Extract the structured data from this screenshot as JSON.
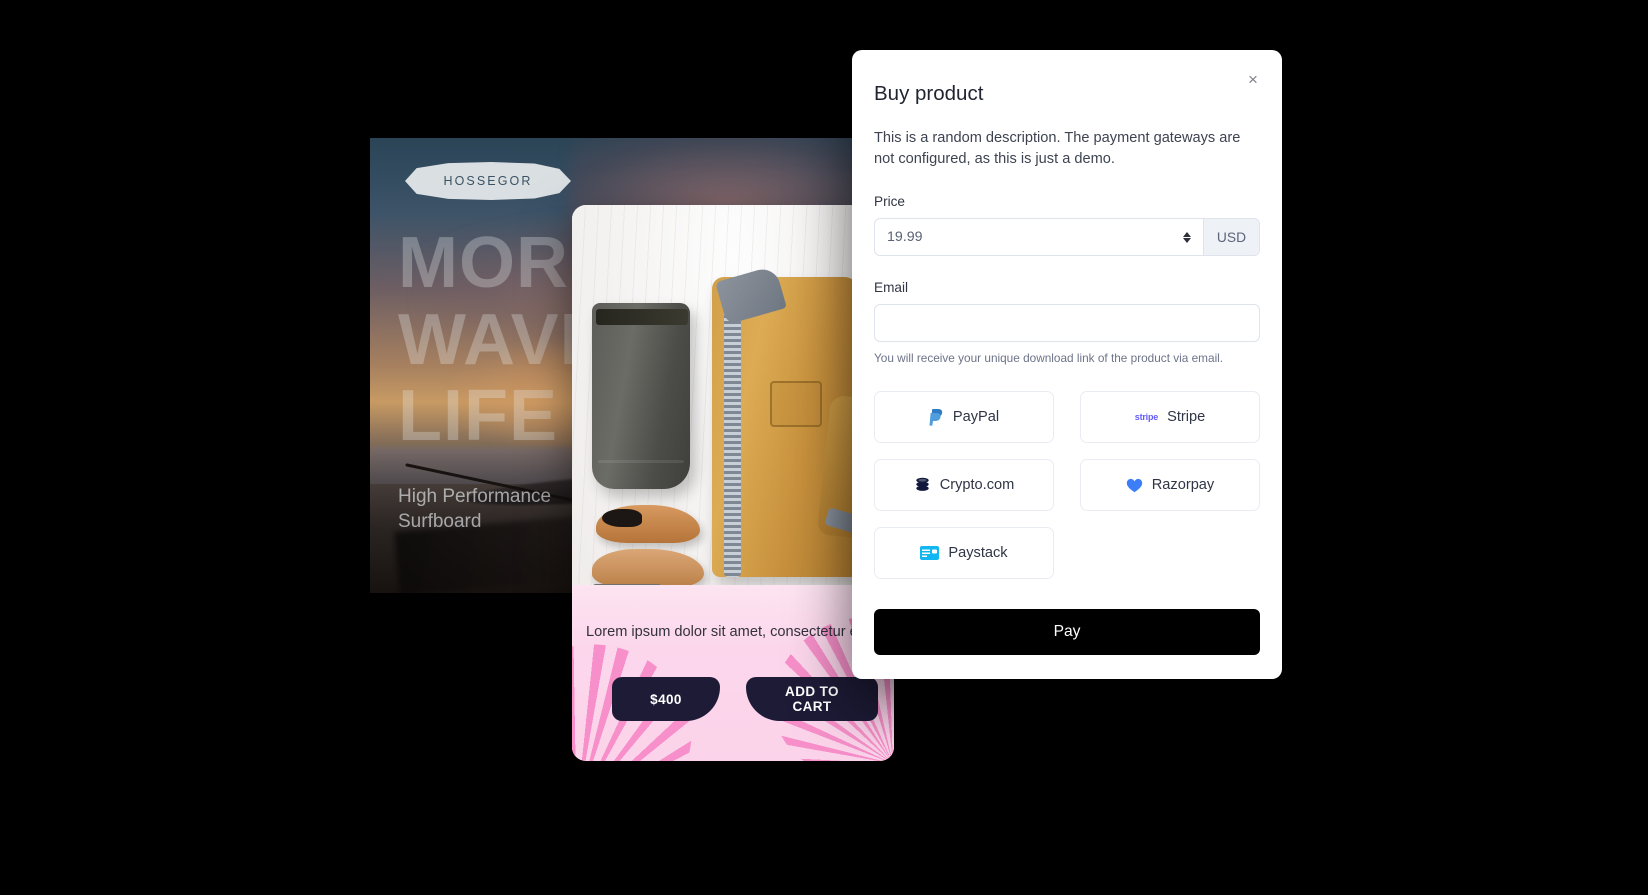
{
  "background_color": "#000000",
  "poster": {
    "badge_label": "HOSSEGOR",
    "headline_lines": [
      "MORE",
      "WAVE",
      "LIFE"
    ],
    "subtitle": "High Performance Surfboard"
  },
  "product_card": {
    "description": "Lorem ipsum dolor sit amet, consectetur e Nased justo ut arcu consectetur dictum.",
    "price_label": "$400",
    "add_to_cart_label": "ADD TO CART"
  },
  "modal": {
    "title": "Buy product",
    "close_label": "×",
    "description": "This is a random description. The payment gateways are not configured, as this is just a demo.",
    "price": {
      "label": "Price",
      "value": "19.99",
      "currency": "USD"
    },
    "email": {
      "label": "Email",
      "value": "",
      "placeholder": "",
      "hint": "You will receive your unique download link of the product via email."
    },
    "gateways": [
      {
        "name": "PayPal",
        "icon": "paypal-icon",
        "color": "#2f7cc2"
      },
      {
        "name": "Stripe",
        "icon": "stripe-icon",
        "color": "#635bff"
      },
      {
        "name": "Crypto.com",
        "icon": "cryptocom-icon",
        "color": "#10183b"
      },
      {
        "name": "Razorpay",
        "icon": "razorpay-icon",
        "color": "#3b7ef7"
      },
      {
        "name": "Paystack",
        "icon": "paystack-icon",
        "color": "#11b7f1"
      }
    ],
    "pay_button_label": "Pay"
  }
}
